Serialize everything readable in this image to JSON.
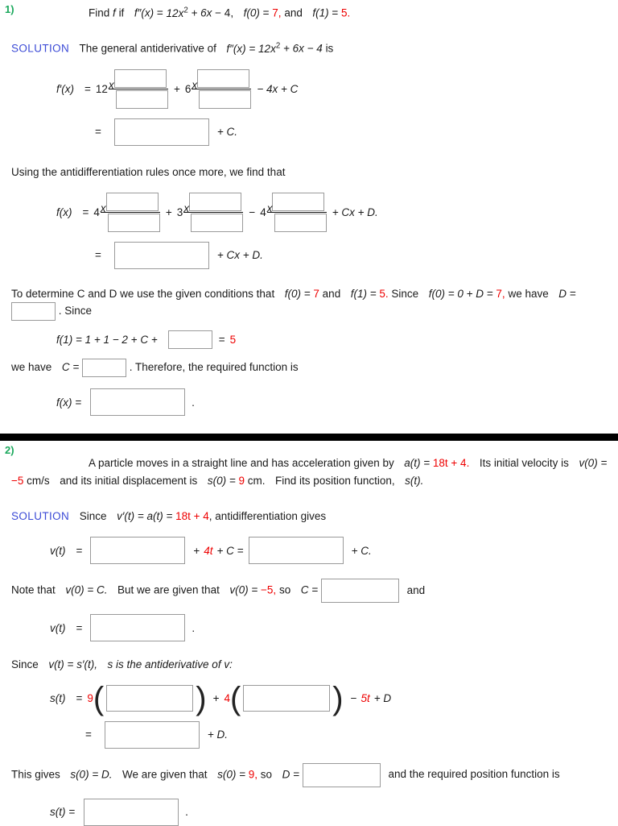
{
  "colors": {
    "question_number": "#1aa85c",
    "solution_label": "#3b4ad6",
    "highlight_red": "#ee0000",
    "box_border": "#9a9a9a",
    "divider": "#000000"
  },
  "problem1": {
    "number": "1)",
    "statement": {
      "find": "Find",
      "f_italic": "f",
      "if": "if",
      "fpp": "f″(x)",
      "eq": "=",
      "expr_12x": "12x",
      "exp2": "2",
      "plus6x": "+ 6x",
      "minus4": "− 4,",
      "f0": "f(0)",
      "f0_val": "7,",
      "and": "and",
      "f1": "f(1)",
      "f1_val": "5."
    },
    "solution_label": "SOLUTION",
    "sol_text_1": "The general antiderivative of",
    "sol_expr": "f″(x) = 12x",
    "sol_expr_exp": "2",
    "sol_expr_rest": "+ 6x − 4",
    "sol_text_2": "is",
    "eq1": {
      "label": "f′(x)",
      "equals": "=",
      "coef1": "12",
      "base1": "x",
      "op1": "+",
      "coef2": "6",
      "base2": "x",
      "tail": "− 4x + C"
    },
    "eq2": {
      "equals": "=",
      "tail": "+ C."
    },
    "para2": "Using the antidifferentiation rules once more, we find that",
    "eq3": {
      "label": "f(x)",
      "equals": "=",
      "coef1": "4",
      "base1": "x",
      "op1": "+",
      "coef2": "3",
      "base2": "x",
      "op2": "−",
      "coef3": "4",
      "base3": "x",
      "tail": "+ Cx + D."
    },
    "eq4": {
      "equals": "=",
      "tail": "+ Cx + D."
    },
    "para3_a": "To determine C and D we use the given conditions that",
    "para3_f0": "f(0) =",
    "para3_f0_val": "7",
    "para3_and": "and",
    "para3_f1": "f(1) =",
    "para3_f1_val": "5.",
    "para3_since": "Since",
    "para3_expr": "f(0) = 0 + D =",
    "para3_expr_val": "7,",
    "para3_we": "we have",
    "para3_D": "D =",
    "para3_since2": ". Since",
    "eq5": {
      "label": "f(1) = 1 + 1 − 2 + C +",
      "equals": "=",
      "value": "5"
    },
    "para4_a": "we have",
    "para4_C": "C =",
    "para4_b": ". Therefore, the required function is",
    "eq6": {
      "label": "f(x) =",
      "period": "."
    }
  },
  "problem2": {
    "number": "2)",
    "statement_a": "A particle moves in a straight line and has acceleration given by",
    "statement_at": "a(t) =",
    "statement_at_val": "18t + 4.",
    "statement_b": "Its initial velocity is",
    "statement_v0": "v(0) =",
    "statement_v0_val": "−5",
    "statement_units1": "cm/s",
    "statement_c": "and its initial displacement is",
    "statement_s0": "s(0) =",
    "statement_s0_val": "9",
    "statement_units2": "cm.",
    "statement_d": "Find its position function,",
    "statement_st": "s(t)."
  },
  "problem2_solution": {
    "solution_label": "SOLUTION",
    "sol_text_1": "Since",
    "sol_expr": "v′(t) = a(t) =",
    "sol_expr_val": "18t + 4",
    "sol_text_2": ", antidifferentiation gives",
    "eq1": {
      "label": "v(t)",
      "equals": "=",
      "mid_plus": "+",
      "mid_val": "4t",
      "mid_rest": "+ C =",
      "tail": "+ C."
    },
    "para1_a": "Note that",
    "para1_v0C": "v(0) = C.",
    "para1_b": "But we are given that",
    "para1_v0": "v(0) =",
    "para1_v0_val": "−5,",
    "para1_so": "so",
    "para1_C": "C =",
    "para1_and": "and",
    "eq2": {
      "label": "v(t)",
      "equals": "=",
      "period": "."
    },
    "para2_a": "Since",
    "para2_expr": "v(t) = s′(t),",
    "para2_b": "s is the antiderivative of v:",
    "eq3": {
      "label": "s(t)",
      "equals": "=",
      "coef1": "9",
      "lparen": "(",
      "rparen": ")",
      "op": "+",
      "coef2": "4",
      "tail": "− 5t + D",
      "tail_red": "5t",
      "tail_pre": "−",
      "tail_post": "+ D"
    },
    "eq4": {
      "equals": "=",
      "tail": "+ D."
    },
    "para3_a": "This gives",
    "para3_s0D": "s(0) = D.",
    "para3_b": "We are given that",
    "para3_s0": "s(0) =",
    "para3_s0_val": "9,",
    "para3_so": "so",
    "para3_D": "D =",
    "para3_c": "and the required position function is",
    "eq5": {
      "label": "s(t) =",
      "period": "."
    }
  }
}
